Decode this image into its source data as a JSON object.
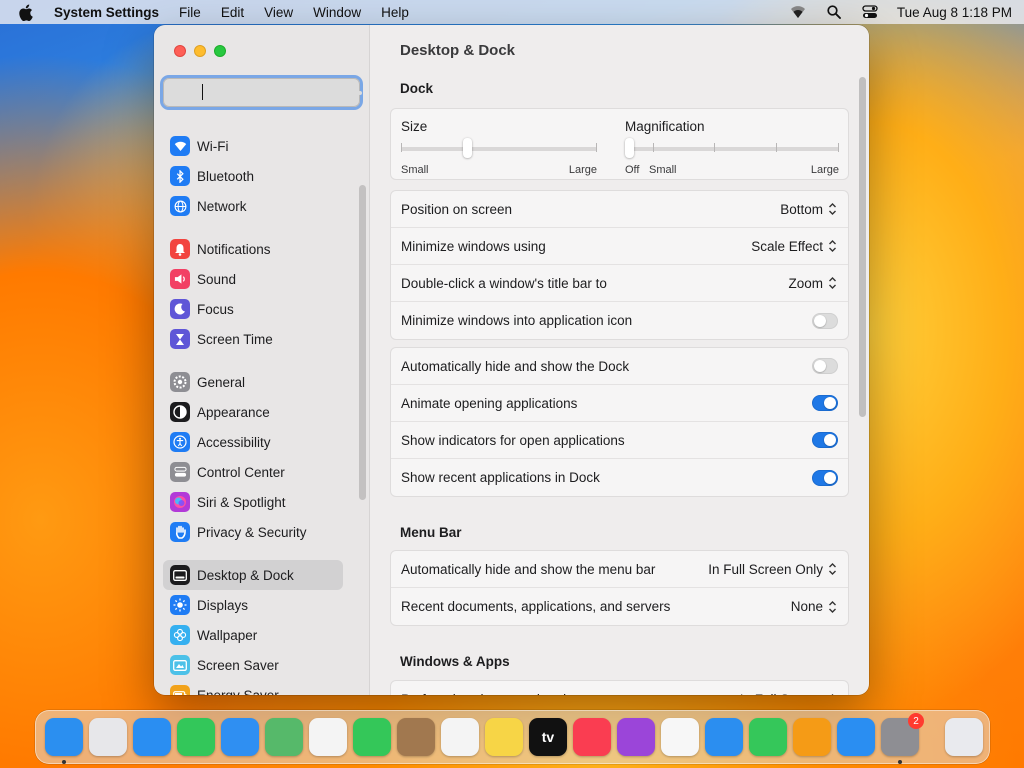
{
  "menubar": {
    "app_name": "System Settings",
    "menus": [
      "File",
      "Edit",
      "View",
      "Window",
      "Help"
    ],
    "datetime": "Tue Aug 8  1:18 PM"
  },
  "search": {
    "value": "",
    "placeholder": ""
  },
  "sidebar": {
    "items": [
      {
        "label": "Wi-Fi",
        "icon": "wifi-icon",
        "color": "#1f7cf4"
      },
      {
        "label": "Bluetooth",
        "icon": "bluetooth-icon",
        "color": "#1f7cf4"
      },
      {
        "label": "Network",
        "icon": "globe-icon",
        "color": "#1f7cf4"
      },
      {
        "label": "Notifications",
        "icon": "bell-icon",
        "color": "#f2443f"
      },
      {
        "label": "Sound",
        "icon": "speaker-icon",
        "color": "#f24064"
      },
      {
        "label": "Focus",
        "icon": "moon-icon",
        "color": "#5f56d7"
      },
      {
        "label": "Screen Time",
        "icon": "hourglass-icon",
        "color": "#5f56d7"
      },
      {
        "label": "General",
        "icon": "gear-icon",
        "color": "#8e8e93"
      },
      {
        "label": "Appearance",
        "icon": "appearance-icon",
        "color": "#1c1c1e"
      },
      {
        "label": "Accessibility",
        "icon": "accessibility-icon",
        "color": "#1f7cf4"
      },
      {
        "label": "Control Center",
        "icon": "control-center-icon",
        "color": "#8e8e93"
      },
      {
        "label": "Siri & Spotlight",
        "icon": "siri-icon",
        "color": "#b23ad8"
      },
      {
        "label": "Privacy & Security",
        "icon": "hand-icon",
        "color": "#1f7cf4"
      },
      {
        "label": "Desktop & Dock",
        "icon": "dock-icon",
        "color": "#1c1c1e"
      },
      {
        "label": "Displays",
        "icon": "sun-icon",
        "color": "#1f7cf4"
      },
      {
        "label": "Wallpaper",
        "icon": "flower-icon",
        "color": "#36b0f0"
      },
      {
        "label": "Screen Saver",
        "icon": "screensaver-icon",
        "color": "#4cc1e8"
      },
      {
        "label": "Energy Saver",
        "icon": "battery-icon",
        "color": "#f2a31b"
      }
    ],
    "selected": "Desktop & Dock"
  },
  "main": {
    "title": "Desktop & Dock",
    "dock_section": "Dock",
    "size": {
      "label": "Size",
      "min": "Small",
      "max": "Large",
      "value": 0.33
    },
    "magnification": {
      "label": "Magnification",
      "off": "Off",
      "min": "Small",
      "max": "Large",
      "value": 0.0
    },
    "settings_a": [
      {
        "label": "Position on screen",
        "value": "Bottom"
      },
      {
        "label": "Minimize windows using",
        "value": "Scale Effect"
      },
      {
        "label": "Double-click a window's title bar to",
        "value": "Zoom"
      },
      {
        "label": "Minimize windows into application icon",
        "toggle": false
      }
    ],
    "settings_b": [
      {
        "label": "Automatically hide and show the Dock",
        "toggle": false
      },
      {
        "label": "Animate opening applications",
        "toggle": true
      },
      {
        "label": "Show indicators for open applications",
        "toggle": true
      },
      {
        "label": "Show recent applications in Dock",
        "toggle": true
      }
    ],
    "menubar_section": "Menu Bar",
    "settings_c": [
      {
        "label": "Automatically hide and show the menu bar",
        "value": "In Full Screen Only"
      },
      {
        "label": "Recent documents, applications, and servers",
        "value": "None"
      }
    ],
    "windows_section": "Windows & Apps",
    "settings_d": [
      {
        "label": "Prefer tabs when opening documents",
        "value": "In Full Screen"
      }
    ]
  },
  "dock": {
    "apps": [
      {
        "name": "finder-icon",
        "color": "#2b8ff0",
        "running": true
      },
      {
        "name": "launchpad-icon",
        "color": "#e7e7ea"
      },
      {
        "name": "safari-icon",
        "color": "#2a8ef2"
      },
      {
        "name": "messages-icon",
        "color": "#33c75a"
      },
      {
        "name": "mail-icon",
        "color": "#2f8ff2"
      },
      {
        "name": "maps-icon",
        "color": "#56b96a"
      },
      {
        "name": "photos-icon",
        "color": "#f4f4f4"
      },
      {
        "name": "facetime-icon",
        "color": "#34c759"
      },
      {
        "name": "contacts-icon",
        "color": "#a1784f"
      },
      {
        "name": "reminders-icon",
        "color": "#f4f4f4"
      },
      {
        "name": "notes-icon",
        "color": "#f7d546"
      },
      {
        "name": "tv-icon",
        "color": "#111111",
        "text": "tv"
      },
      {
        "name": "music-icon",
        "color": "#fa3d51"
      },
      {
        "name": "podcasts-icon",
        "color": "#9b45d9"
      },
      {
        "name": "news-icon",
        "color": "#f7f7f7"
      },
      {
        "name": "keynote-icon",
        "color": "#2b8ef0"
      },
      {
        "name": "numbers-icon",
        "color": "#35c75a"
      },
      {
        "name": "pages-icon",
        "color": "#f59b16"
      },
      {
        "name": "app-store-icon",
        "color": "#2a8ef2"
      },
      {
        "name": "system-settings-icon",
        "color": "#8e8e93",
        "badge": "2",
        "running": true
      }
    ],
    "trash": {
      "name": "trash-icon",
      "color": "#e9eaee"
    }
  }
}
